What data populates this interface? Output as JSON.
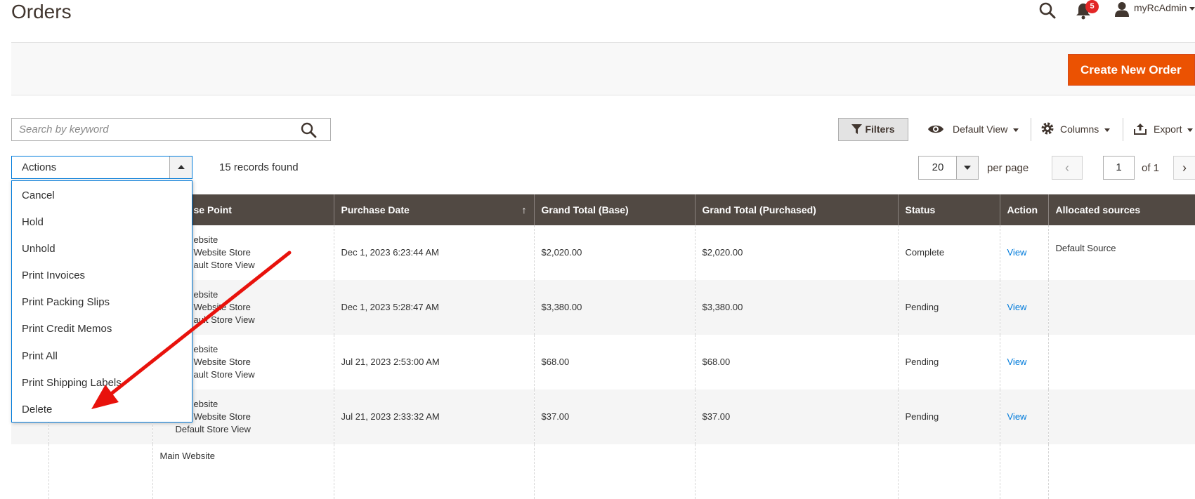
{
  "header": {
    "title": "Orders",
    "notifications_count": "5",
    "user_name": "myRcAdmin"
  },
  "actionbar": {
    "create_label": "Create New Order"
  },
  "search": {
    "placeholder": "Search by keyword",
    "value": ""
  },
  "toolbar": {
    "filters_label": "Filters",
    "view_label": "Default View",
    "columns_label": "Columns",
    "export_label": "Export"
  },
  "mass_actions": {
    "label": "Actions",
    "records_found": "15 records found",
    "items": [
      "Cancel",
      "Hold",
      "Unhold",
      "Print Invoices",
      "Print Packing Slips",
      "Print Credit Memos",
      "Print All",
      "Print Shipping Labels",
      "Delete"
    ]
  },
  "pagination": {
    "per_page": "20",
    "per_page_label": "per page",
    "current_page": "1",
    "of_label": "of 1"
  },
  "grid": {
    "columns": [
      "",
      "",
      "Purchase Point",
      "Purchase Date",
      "Grand Total (Base)",
      "Grand Total (Purchased)",
      "Status",
      "Action",
      "Allocated sources"
    ],
    "visible_column_labels": [
      "se Point",
      "Purchase Date",
      "Grand Total (Base)",
      "Grand Total (Purchased)",
      "Status",
      "Action",
      "Allocated sources"
    ],
    "sort_indicator": "↑",
    "rows": [
      {
        "pp1": "ebsite",
        "pp2": "Website Store",
        "pp3": "ault Store View",
        "date": "Dec 1, 2023 6:23:44 AM",
        "base": "$2,020.00",
        "purchased": "$2,020.00",
        "status": "Complete",
        "action": "View",
        "source": "Default Source"
      },
      {
        "pp1": "ebsite",
        "pp2": "Website Store",
        "pp3": "ault Store View",
        "date": "Dec 1, 2023 5:28:47 AM",
        "base": "$3,380.00",
        "purchased": "$3,380.00",
        "status": "Pending",
        "action": "View",
        "source": ""
      },
      {
        "pp1": "ebsite",
        "pp2": "Website Store",
        "pp3": "ault Store View",
        "date": "Jul 21, 2023 2:53:00 AM",
        "base": "$68.00",
        "purchased": "$68.00",
        "status": "Pending",
        "action": "View",
        "source": ""
      },
      {
        "pp1": "ebsite",
        "pp2": "Website Store",
        "pp3": "Default Store View",
        "date": "Jul 21, 2023 2:33:32 AM",
        "base": "$37.00",
        "purchased": "$37.00",
        "status": "Pending",
        "action": "View",
        "source": ""
      },
      {
        "pp1": "Main Website",
        "pp2": "",
        "pp3": "",
        "date": "",
        "base": "",
        "purchased": "",
        "status": "",
        "action": "",
        "source": ""
      }
    ]
  },
  "colors": {
    "accent": "#eb5202",
    "grid_header": "#514943",
    "link": "#007bdb",
    "annotation_arrow": "#e8120c"
  }
}
